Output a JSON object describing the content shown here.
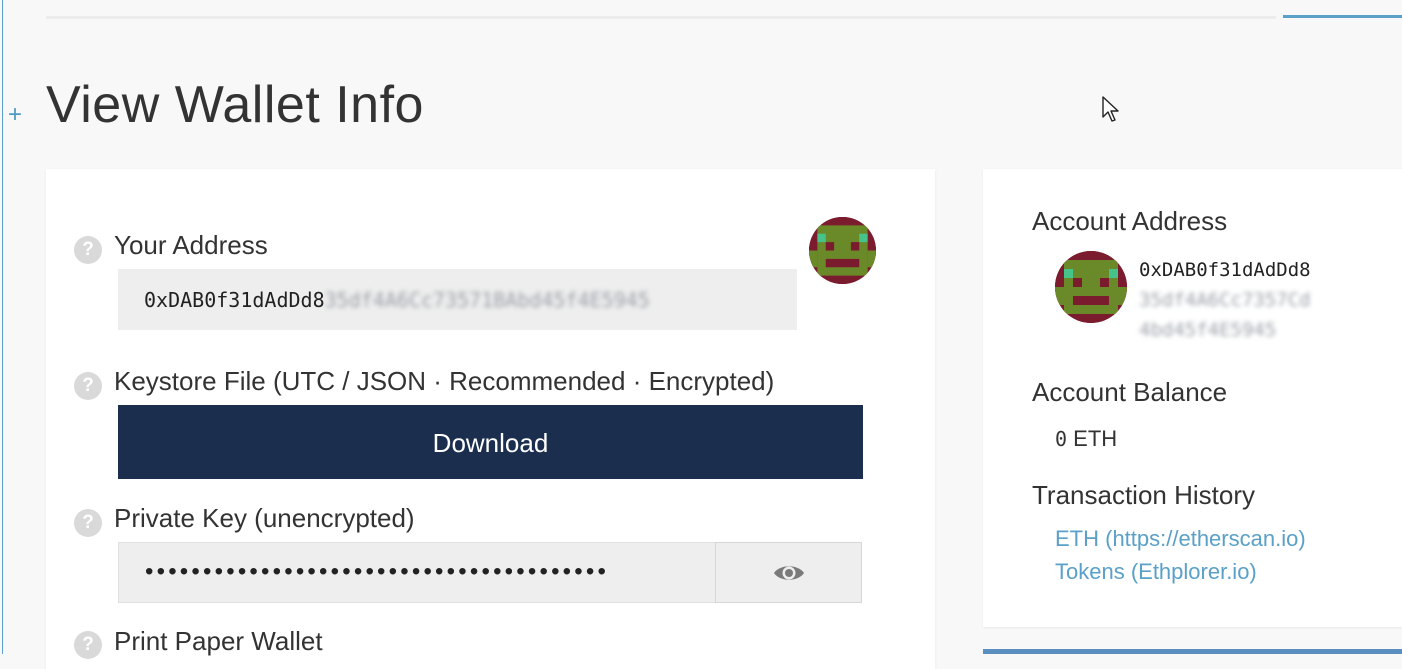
{
  "page": {
    "title": "View Wallet Info"
  },
  "wallet": {
    "address_label": "Your Address",
    "address_visible": "0xDAB0f31dAdDd8",
    "address_blurred": "35df4A6Cc73571BAbd45f4E5945",
    "keystore_label": "Keystore File (UTC / JSON · Recommended · Encrypted)",
    "download_label": "Download",
    "private_key_label": "Private Key (unencrypted)",
    "private_key_masked": "••••••••••••••••••••••••••••••••••••••••",
    "print_label": "Print Paper Wallet"
  },
  "account": {
    "address_label": "Account Address",
    "address_line1": "0xDAB0f31dAdDd8",
    "address_line2": "35df4A6Cc7357Cd",
    "address_line3": "4bd45f4E5945",
    "balance_label": "Account Balance",
    "balance_value": "0",
    "balance_unit": "ETH",
    "history_label": "Transaction History",
    "link_eth": "ETH (https://etherscan.io)",
    "link_tokens": "Tokens (Ethplorer.io)"
  },
  "icons": {
    "help": "question-circle-icon",
    "eye": "eye-icon",
    "identicon": "identicon-avatar",
    "plus": "plus-icon",
    "cursor": "mouse-pointer-icon"
  },
  "colors": {
    "accent": "#5aa0c8",
    "button": "#1b2e4e",
    "identicon_bg": "#7a1b2e",
    "identicon_fg": "#6a8a2a"
  }
}
